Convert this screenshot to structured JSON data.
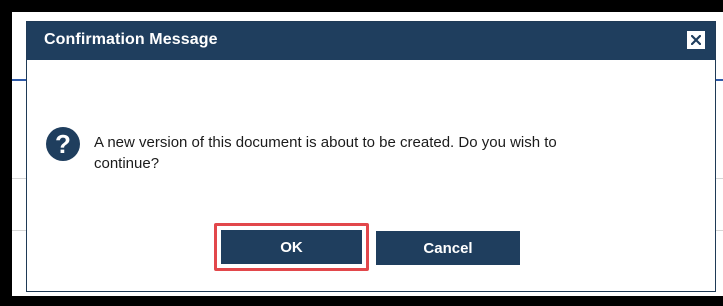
{
  "dialog": {
    "title": "Confirmation Message",
    "message": "A new version of this document is about to be created. Do you wish to continue?",
    "icon": "question-icon"
  },
  "buttons": {
    "ok_label": "OK",
    "cancel_label": "Cancel"
  },
  "colors": {
    "header_bg": "#1f3e5e",
    "button_bg": "#1f3e5e",
    "highlight": "#e2474b"
  }
}
